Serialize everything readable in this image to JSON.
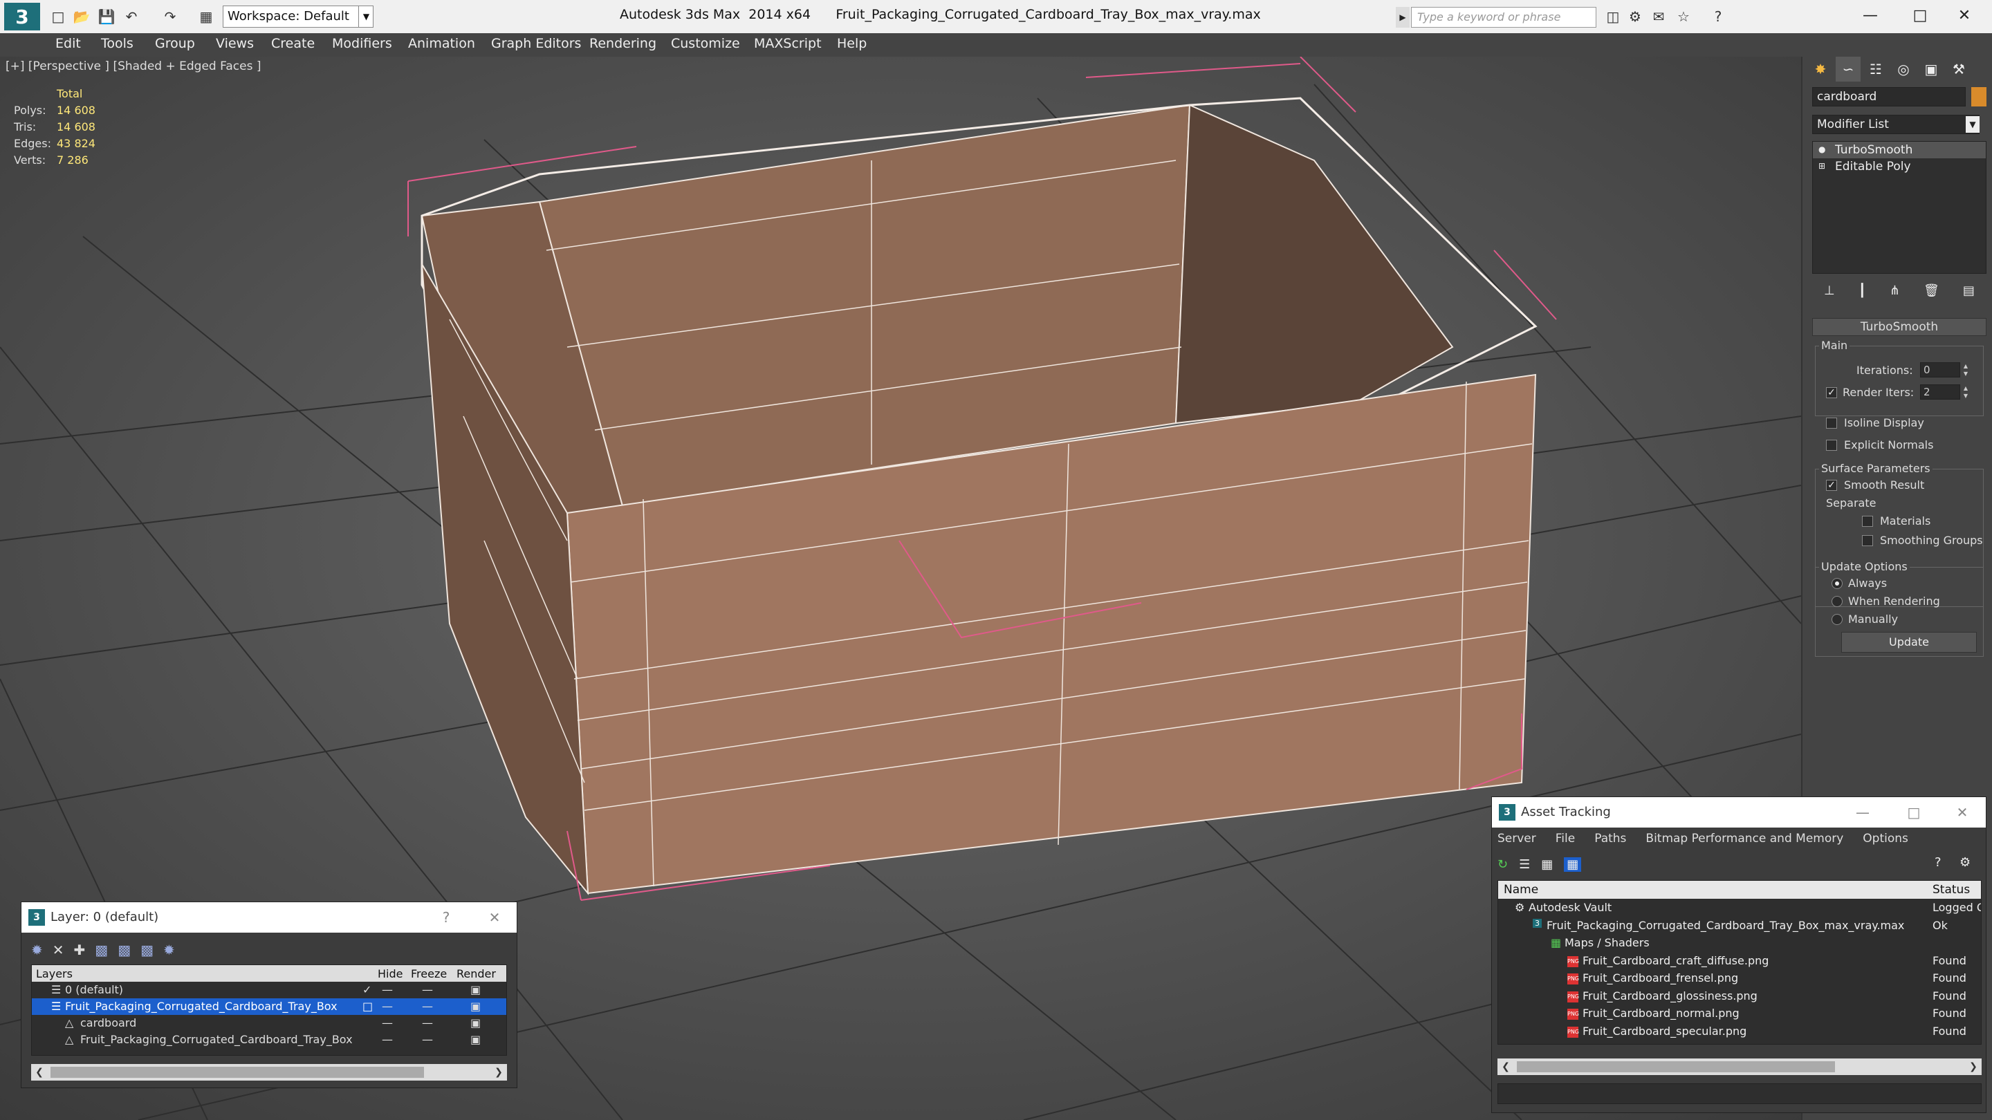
{
  "titlebar": {
    "app_title": "Autodesk 3ds Max  2014 x64",
    "file_name": "Fruit_Packaging_Corrugated_Cardboard_Tray_Box_max_vray.max",
    "workspace": "Workspace: Default",
    "search_placeholder": "Type a keyword or phrase"
  },
  "menu": [
    "Edit",
    "Tools",
    "Group",
    "Views",
    "Create",
    "Modifiers",
    "Animation",
    "Graph Editors",
    "Rendering",
    "Customize",
    "MAXScript",
    "Help"
  ],
  "viewport": {
    "label": "[+] [Perspective ] [Shaded + Edged Faces ]",
    "stats": {
      "header": "Total",
      "rows": [
        {
          "k": "Polys:",
          "v": "14 608"
        },
        {
          "k": "Tris:",
          "v": "14 608"
        },
        {
          "k": "Edges:",
          "v": "43 824"
        },
        {
          "k": "Verts:",
          "v": "7 286"
        }
      ]
    }
  },
  "command_panel": {
    "object_name": "cardboard",
    "modifier_list": "Modifier List",
    "stack": [
      "TurboSmooth",
      "Editable Poly"
    ],
    "rollout_title": "TurboSmooth",
    "main_label": "Main",
    "iterations_label": "Iterations:",
    "iterations_value": "0",
    "render_iters_label": "Render Iters:",
    "render_iters_value": "2",
    "isoline_label": "Isoline Display",
    "explicit_normals_label": "Explicit Normals",
    "surface_params_label": "Surface Parameters",
    "smooth_result_label": "Smooth Result",
    "separate_label": "Separate",
    "materials_label": "Materials",
    "smoothing_groups_label": "Smoothing Groups",
    "update_options_label": "Update Options",
    "always_label": "Always",
    "when_rendering_label": "When Rendering",
    "manually_label": "Manually",
    "update_button": "Update"
  },
  "layer_dialog": {
    "title": "Layer: 0 (default)",
    "columns": {
      "layers": "Layers",
      "hide": "Hide",
      "freeze": "Freeze",
      "render": "Render"
    },
    "rows": [
      {
        "name": "0 (default)"
      },
      {
        "name": "Fruit_Packaging_Corrugated_Cardboard_Tray_Box"
      },
      {
        "name": "cardboard"
      },
      {
        "name": "Fruit_Packaging_Corrugated_Cardboard_Tray_Box"
      }
    ]
  },
  "asset_tracking": {
    "title": "Asset Tracking",
    "menu": [
      "Server",
      "File",
      "Paths",
      "Bitmap Performance and Memory",
      "Options"
    ],
    "columns": {
      "name": "Name",
      "status": "Status"
    },
    "rows": [
      {
        "name": "Autodesk Vault",
        "status": "Logged O"
      },
      {
        "name": "Fruit_Packaging_Corrugated_Cardboard_Tray_Box_max_vray.max",
        "status": "Ok"
      },
      {
        "name": "Maps / Shaders",
        "status": ""
      },
      {
        "name": "Fruit_Cardboard_craft_diffuse.png",
        "status": "Found"
      },
      {
        "name": "Fruit_Cardboard_frensel.png",
        "status": "Found"
      },
      {
        "name": "Fruit_Cardboard_glossiness.png",
        "status": "Found"
      },
      {
        "name": "Fruit_Cardboard_normal.png",
        "status": "Found"
      },
      {
        "name": "Fruit_Cardboard_specular.png",
        "status": "Found"
      }
    ]
  }
}
